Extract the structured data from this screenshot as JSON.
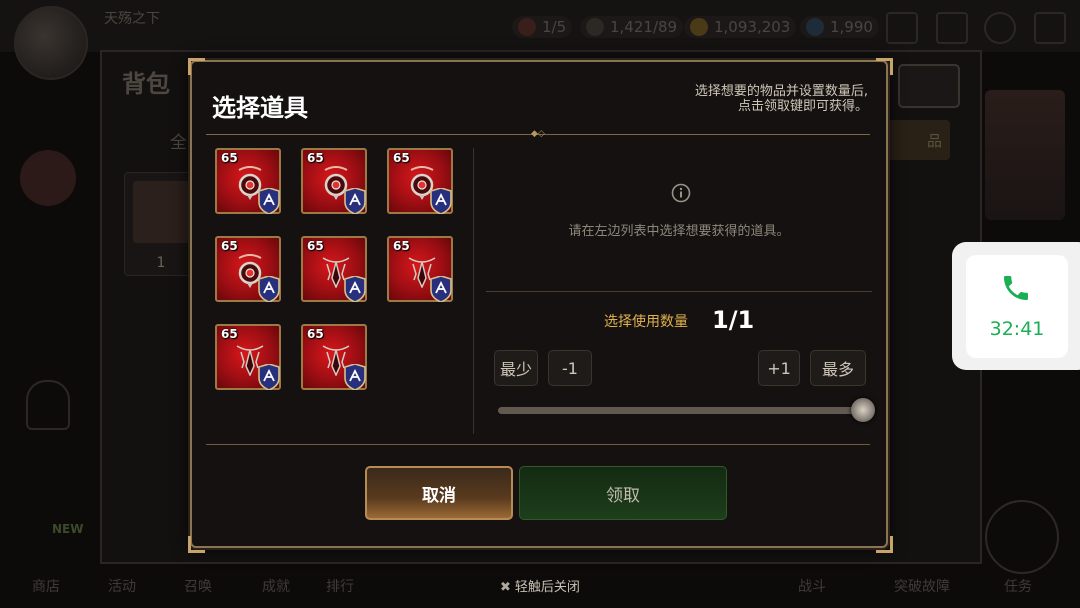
{
  "background": {
    "top_bar": {
      "player_name": "天殇之下",
      "stats": [
        "1/5",
        "1,421/89",
        "1,093,203",
        "1,990"
      ]
    },
    "panel_title": "背包",
    "tab_all": "全",
    "tab_right": "品",
    "item_count": "1",
    "bottom_nav": [
      "商店",
      "活动",
      "召唤",
      "成就",
      "排行",
      "战斗",
      "突破故障",
      "任务"
    ],
    "new_badge": "NEW"
  },
  "call_widget": {
    "time": "32:41",
    "color": "#1aaf54"
  },
  "modal": {
    "title": "选择道具",
    "hint_line1": "选择想要的物品并设置数量后,",
    "hint_line2": "点击领取键即可获得。",
    "items": [
      {
        "level": "65",
        "type": "red-amulet"
      },
      {
        "level": "65",
        "type": "red-amulet"
      },
      {
        "level": "65",
        "type": "red-amulet"
      },
      {
        "level": "65",
        "type": "red-amulet"
      },
      {
        "level": "65",
        "type": "red-spike-necklace"
      },
      {
        "level": "65",
        "type": "red-spike-necklace"
      },
      {
        "level": "65",
        "type": "red-spike-necklace"
      },
      {
        "level": "65",
        "type": "red-spike-necklace"
      }
    ],
    "empty_message": "请在左边列表中选择想要获得的道具。",
    "quantity_label": "选择使用数量",
    "quantity_value": "1/1",
    "btn_min": "最少",
    "btn_minus": "-1",
    "btn_plus": "+1",
    "btn_max": "最多",
    "slider_value": 1,
    "btn_cancel": "取消",
    "btn_claim": "领取"
  },
  "close_hint": "轻触后关闭",
  "colors": {
    "accent_gold": "#c8a46a",
    "qty_label": "#e0b14e",
    "item_red": "#c51318"
  }
}
